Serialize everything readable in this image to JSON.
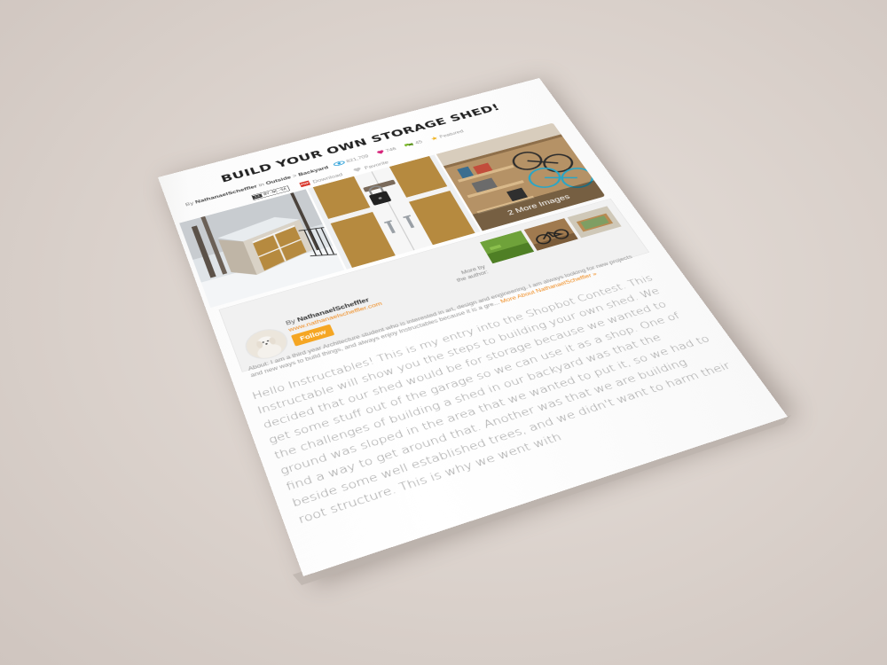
{
  "article": {
    "title": "BUILD YOUR OWN STORAGE SHED!",
    "by_prefix": "By",
    "author": "NathanaelScheffler",
    "in_text": "in",
    "category": "Outside",
    "separator": ">",
    "subcategory": "Backyard",
    "stats": {
      "views": "821,709",
      "favorites": "746",
      "comments": "45",
      "featured": "Featured"
    },
    "license": "BY-NC-SA",
    "download_label": "Download",
    "favorite_label": "Favorite",
    "more_images": "2 More Images"
  },
  "author_box": {
    "by_label": "By",
    "name": "NathanaelScheffler",
    "website": "www.nathanaelscheffler.com",
    "follow_label": "Follow",
    "more_by_label": "More by the author:",
    "about_prefix": "About:",
    "about_text": "I am a third year Architecture student who is interested in art, design and engineering. I am always looking for new projects and new ways to build things, and always enjoy Instructables because it is a gre...",
    "more_about": "More About NathanaelScheffler »"
  },
  "body_text": "Hello Instructables!  This is my entry into the Shopbot Contest.  This Instructable will show you the steps to building your own shed.  We decided that our shed would be for storage because we wanted to get some stuff out of the garage so we can use it as a shop.  One of the challenges of building a shed in our backyard was that the ground was sloped in the area that we wanted to put it, so we had to find a way to get around that.  Another was that we are building beside some well established trees, and we didn't want to harm their root structure.  This is why we went with",
  "colors": {
    "accent_orange": "#f5a623",
    "link_orange": "#f08a1c",
    "views_blue": "#2a9fd8",
    "heart_pink": "#d6237a",
    "comments_green": "#7ab829",
    "star_gold": "#f0b323",
    "download_red": "#d9362b"
  }
}
